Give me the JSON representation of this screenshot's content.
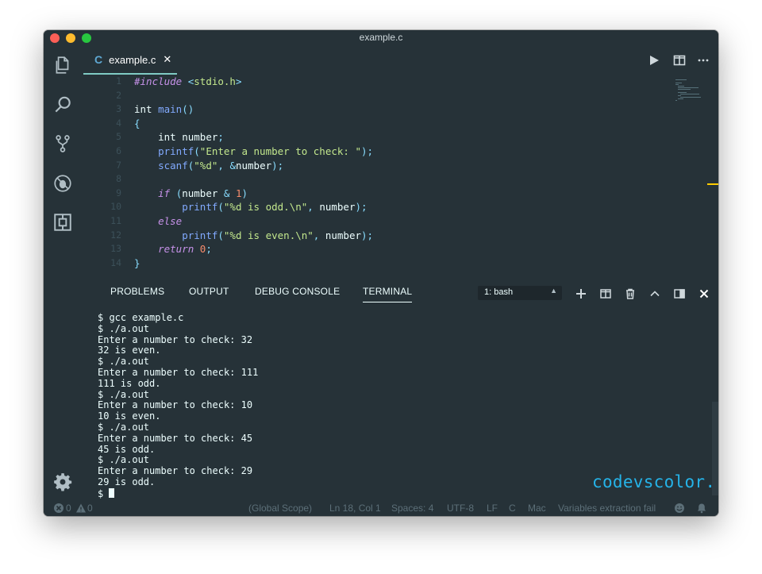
{
  "window": {
    "title": "example.c"
  },
  "activity_bar": {
    "items": [
      {
        "name": "explorer-icon"
      },
      {
        "name": "search-icon"
      },
      {
        "name": "source-control-icon"
      },
      {
        "name": "debug-icon"
      },
      {
        "name": "extensions-icon"
      }
    ],
    "settings": {
      "name": "gear-icon"
    }
  },
  "editor": {
    "tab": {
      "lang": "C",
      "name": "example.c",
      "close": "✕"
    },
    "line_numbers": [
      "1",
      "2",
      "3",
      "4",
      "5",
      "6",
      "7",
      "8",
      "9",
      "10",
      "11",
      "12",
      "13",
      "14"
    ],
    "lines": [
      "#include <stdio.h>",
      "",
      "int main()",
      "{",
      "    int number;",
      "    printf(\"Enter a number to check: \");",
      "    scanf(\"%d\", &number);",
      "",
      "    if (number & 1)",
      "        printf(\"%d is odd.\\n\", number);",
      "    else",
      "        printf(\"%d is even.\\n\", number);",
      "    return 0;",
      "}"
    ]
  },
  "panel": {
    "tabs": [
      "PROBLEMS",
      "OUTPUT",
      "DEBUG CONSOLE",
      "TERMINAL"
    ],
    "active_tab": "TERMINAL",
    "terminal_select": "1: bash",
    "terminal_lines": [
      "$ gcc example.c",
      "$ ./a.out",
      "Enter a number to check: 32",
      "32 is even.",
      "$ ./a.out",
      "Enter a number to check: 111",
      "111 is odd.",
      "$ ./a.out",
      "Enter a number to check: 10",
      "10 is even.",
      "$ ./a.out",
      "Enter a number to check: 45",
      "45 is odd.",
      "$ ./a.out",
      "Enter a number to check: 29",
      "29 is odd."
    ],
    "prompt": "$",
    "watermark": "codevscolor.com"
  },
  "statusbar": {
    "errors": "0",
    "warnings": "0",
    "scope": "(Global Scope)",
    "position": "Ln 18, Col 1",
    "spaces": "Spaces: 4",
    "encoding": "UTF-8",
    "eol": "LF",
    "language": "C",
    "platform": "Mac",
    "message": "Variables extraction fail"
  },
  "colors": {
    "background": "#263238",
    "accent": "#80cbc4",
    "watermark": "#25b3e8"
  }
}
